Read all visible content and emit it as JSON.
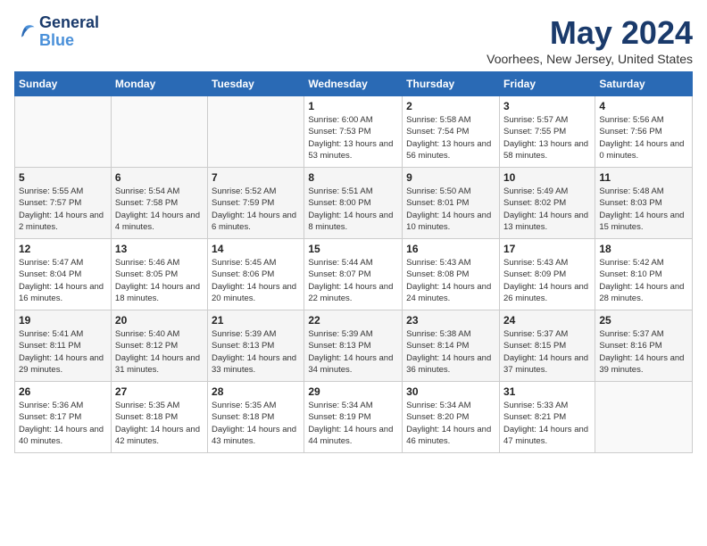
{
  "logo": {
    "line1": "General",
    "line2": "Blue"
  },
  "title": "May 2024",
  "location": "Voorhees, New Jersey, United States",
  "days_of_week": [
    "Sunday",
    "Monday",
    "Tuesday",
    "Wednesday",
    "Thursday",
    "Friday",
    "Saturday"
  ],
  "weeks": [
    [
      {
        "day": "",
        "content": ""
      },
      {
        "day": "",
        "content": ""
      },
      {
        "day": "",
        "content": ""
      },
      {
        "day": "1",
        "content": "Sunrise: 6:00 AM\nSunset: 7:53 PM\nDaylight: 13 hours and 53 minutes."
      },
      {
        "day": "2",
        "content": "Sunrise: 5:58 AM\nSunset: 7:54 PM\nDaylight: 13 hours and 56 minutes."
      },
      {
        "day": "3",
        "content": "Sunrise: 5:57 AM\nSunset: 7:55 PM\nDaylight: 13 hours and 58 minutes."
      },
      {
        "day": "4",
        "content": "Sunrise: 5:56 AM\nSunset: 7:56 PM\nDaylight: 14 hours and 0 minutes."
      }
    ],
    [
      {
        "day": "5",
        "content": "Sunrise: 5:55 AM\nSunset: 7:57 PM\nDaylight: 14 hours and 2 minutes."
      },
      {
        "day": "6",
        "content": "Sunrise: 5:54 AM\nSunset: 7:58 PM\nDaylight: 14 hours and 4 minutes."
      },
      {
        "day": "7",
        "content": "Sunrise: 5:52 AM\nSunset: 7:59 PM\nDaylight: 14 hours and 6 minutes."
      },
      {
        "day": "8",
        "content": "Sunrise: 5:51 AM\nSunset: 8:00 PM\nDaylight: 14 hours and 8 minutes."
      },
      {
        "day": "9",
        "content": "Sunrise: 5:50 AM\nSunset: 8:01 PM\nDaylight: 14 hours and 10 minutes."
      },
      {
        "day": "10",
        "content": "Sunrise: 5:49 AM\nSunset: 8:02 PM\nDaylight: 14 hours and 13 minutes."
      },
      {
        "day": "11",
        "content": "Sunrise: 5:48 AM\nSunset: 8:03 PM\nDaylight: 14 hours and 15 minutes."
      }
    ],
    [
      {
        "day": "12",
        "content": "Sunrise: 5:47 AM\nSunset: 8:04 PM\nDaylight: 14 hours and 16 minutes."
      },
      {
        "day": "13",
        "content": "Sunrise: 5:46 AM\nSunset: 8:05 PM\nDaylight: 14 hours and 18 minutes."
      },
      {
        "day": "14",
        "content": "Sunrise: 5:45 AM\nSunset: 8:06 PM\nDaylight: 14 hours and 20 minutes."
      },
      {
        "day": "15",
        "content": "Sunrise: 5:44 AM\nSunset: 8:07 PM\nDaylight: 14 hours and 22 minutes."
      },
      {
        "day": "16",
        "content": "Sunrise: 5:43 AM\nSunset: 8:08 PM\nDaylight: 14 hours and 24 minutes."
      },
      {
        "day": "17",
        "content": "Sunrise: 5:43 AM\nSunset: 8:09 PM\nDaylight: 14 hours and 26 minutes."
      },
      {
        "day": "18",
        "content": "Sunrise: 5:42 AM\nSunset: 8:10 PM\nDaylight: 14 hours and 28 minutes."
      }
    ],
    [
      {
        "day": "19",
        "content": "Sunrise: 5:41 AM\nSunset: 8:11 PM\nDaylight: 14 hours and 29 minutes."
      },
      {
        "day": "20",
        "content": "Sunrise: 5:40 AM\nSunset: 8:12 PM\nDaylight: 14 hours and 31 minutes."
      },
      {
        "day": "21",
        "content": "Sunrise: 5:39 AM\nSunset: 8:13 PM\nDaylight: 14 hours and 33 minutes."
      },
      {
        "day": "22",
        "content": "Sunrise: 5:39 AM\nSunset: 8:13 PM\nDaylight: 14 hours and 34 minutes."
      },
      {
        "day": "23",
        "content": "Sunrise: 5:38 AM\nSunset: 8:14 PM\nDaylight: 14 hours and 36 minutes."
      },
      {
        "day": "24",
        "content": "Sunrise: 5:37 AM\nSunset: 8:15 PM\nDaylight: 14 hours and 37 minutes."
      },
      {
        "day": "25",
        "content": "Sunrise: 5:37 AM\nSunset: 8:16 PM\nDaylight: 14 hours and 39 minutes."
      }
    ],
    [
      {
        "day": "26",
        "content": "Sunrise: 5:36 AM\nSunset: 8:17 PM\nDaylight: 14 hours and 40 minutes."
      },
      {
        "day": "27",
        "content": "Sunrise: 5:35 AM\nSunset: 8:18 PM\nDaylight: 14 hours and 42 minutes."
      },
      {
        "day": "28",
        "content": "Sunrise: 5:35 AM\nSunset: 8:18 PM\nDaylight: 14 hours and 43 minutes."
      },
      {
        "day": "29",
        "content": "Sunrise: 5:34 AM\nSunset: 8:19 PM\nDaylight: 14 hours and 44 minutes."
      },
      {
        "day": "30",
        "content": "Sunrise: 5:34 AM\nSunset: 8:20 PM\nDaylight: 14 hours and 46 minutes."
      },
      {
        "day": "31",
        "content": "Sunrise: 5:33 AM\nSunset: 8:21 PM\nDaylight: 14 hours and 47 minutes."
      },
      {
        "day": "",
        "content": ""
      }
    ]
  ]
}
